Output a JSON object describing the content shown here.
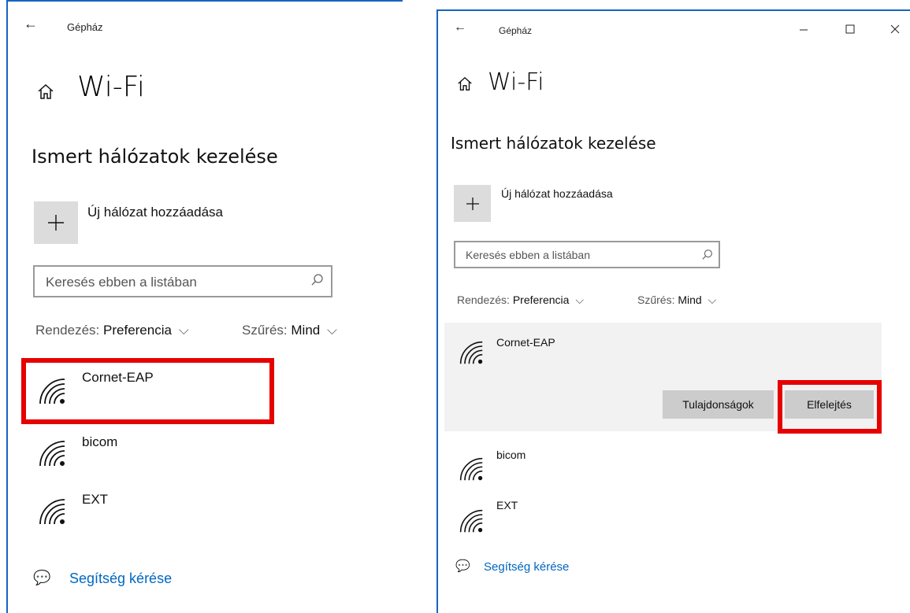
{
  "left": {
    "header": {
      "back_icon": "back-arrow-icon",
      "app_title": "Gépház"
    },
    "page_title": "Wi-Fi",
    "section_title": "Ismert hálózatok kezelése",
    "add_network_label": "Új hálózat hozzáadása",
    "search": {
      "placeholder": "Keresés ebben a listában"
    },
    "sort": {
      "label": "Rendezés:",
      "value": "Preferencia"
    },
    "filter": {
      "label": "Szűrés:",
      "value": "Mind"
    },
    "networks": [
      {
        "name": "Cornet-EAP"
      },
      {
        "name": "bicom"
      },
      {
        "name": "EXT"
      }
    ],
    "help_label": "Segítség kérése"
  },
  "right": {
    "header": {
      "back_icon": "back-arrow-icon",
      "app_title": "Gépház"
    },
    "page_title": "Wi-Fi",
    "section_title": "Ismert hálózatok kezelése",
    "add_network_label": "Új hálózat hozzáadása",
    "search": {
      "placeholder": "Keresés ebben a listában"
    },
    "sort": {
      "label": "Rendezés:",
      "value": "Preferencia"
    },
    "filter": {
      "label": "Szűrés:",
      "value": "Mind"
    },
    "networks": [
      {
        "name": "Cornet-EAP"
      },
      {
        "name": "bicom"
      },
      {
        "name": "EXT"
      }
    ],
    "properties_button": "Tulajdonságok",
    "forget_button": "Elfelejtés",
    "help_label": "Segítség kérése"
  },
  "colors": {
    "accent": "#0067c0",
    "highlight": "#e60000",
    "selected_bg": "#f2f2f2",
    "button_bg": "#cccccc"
  }
}
